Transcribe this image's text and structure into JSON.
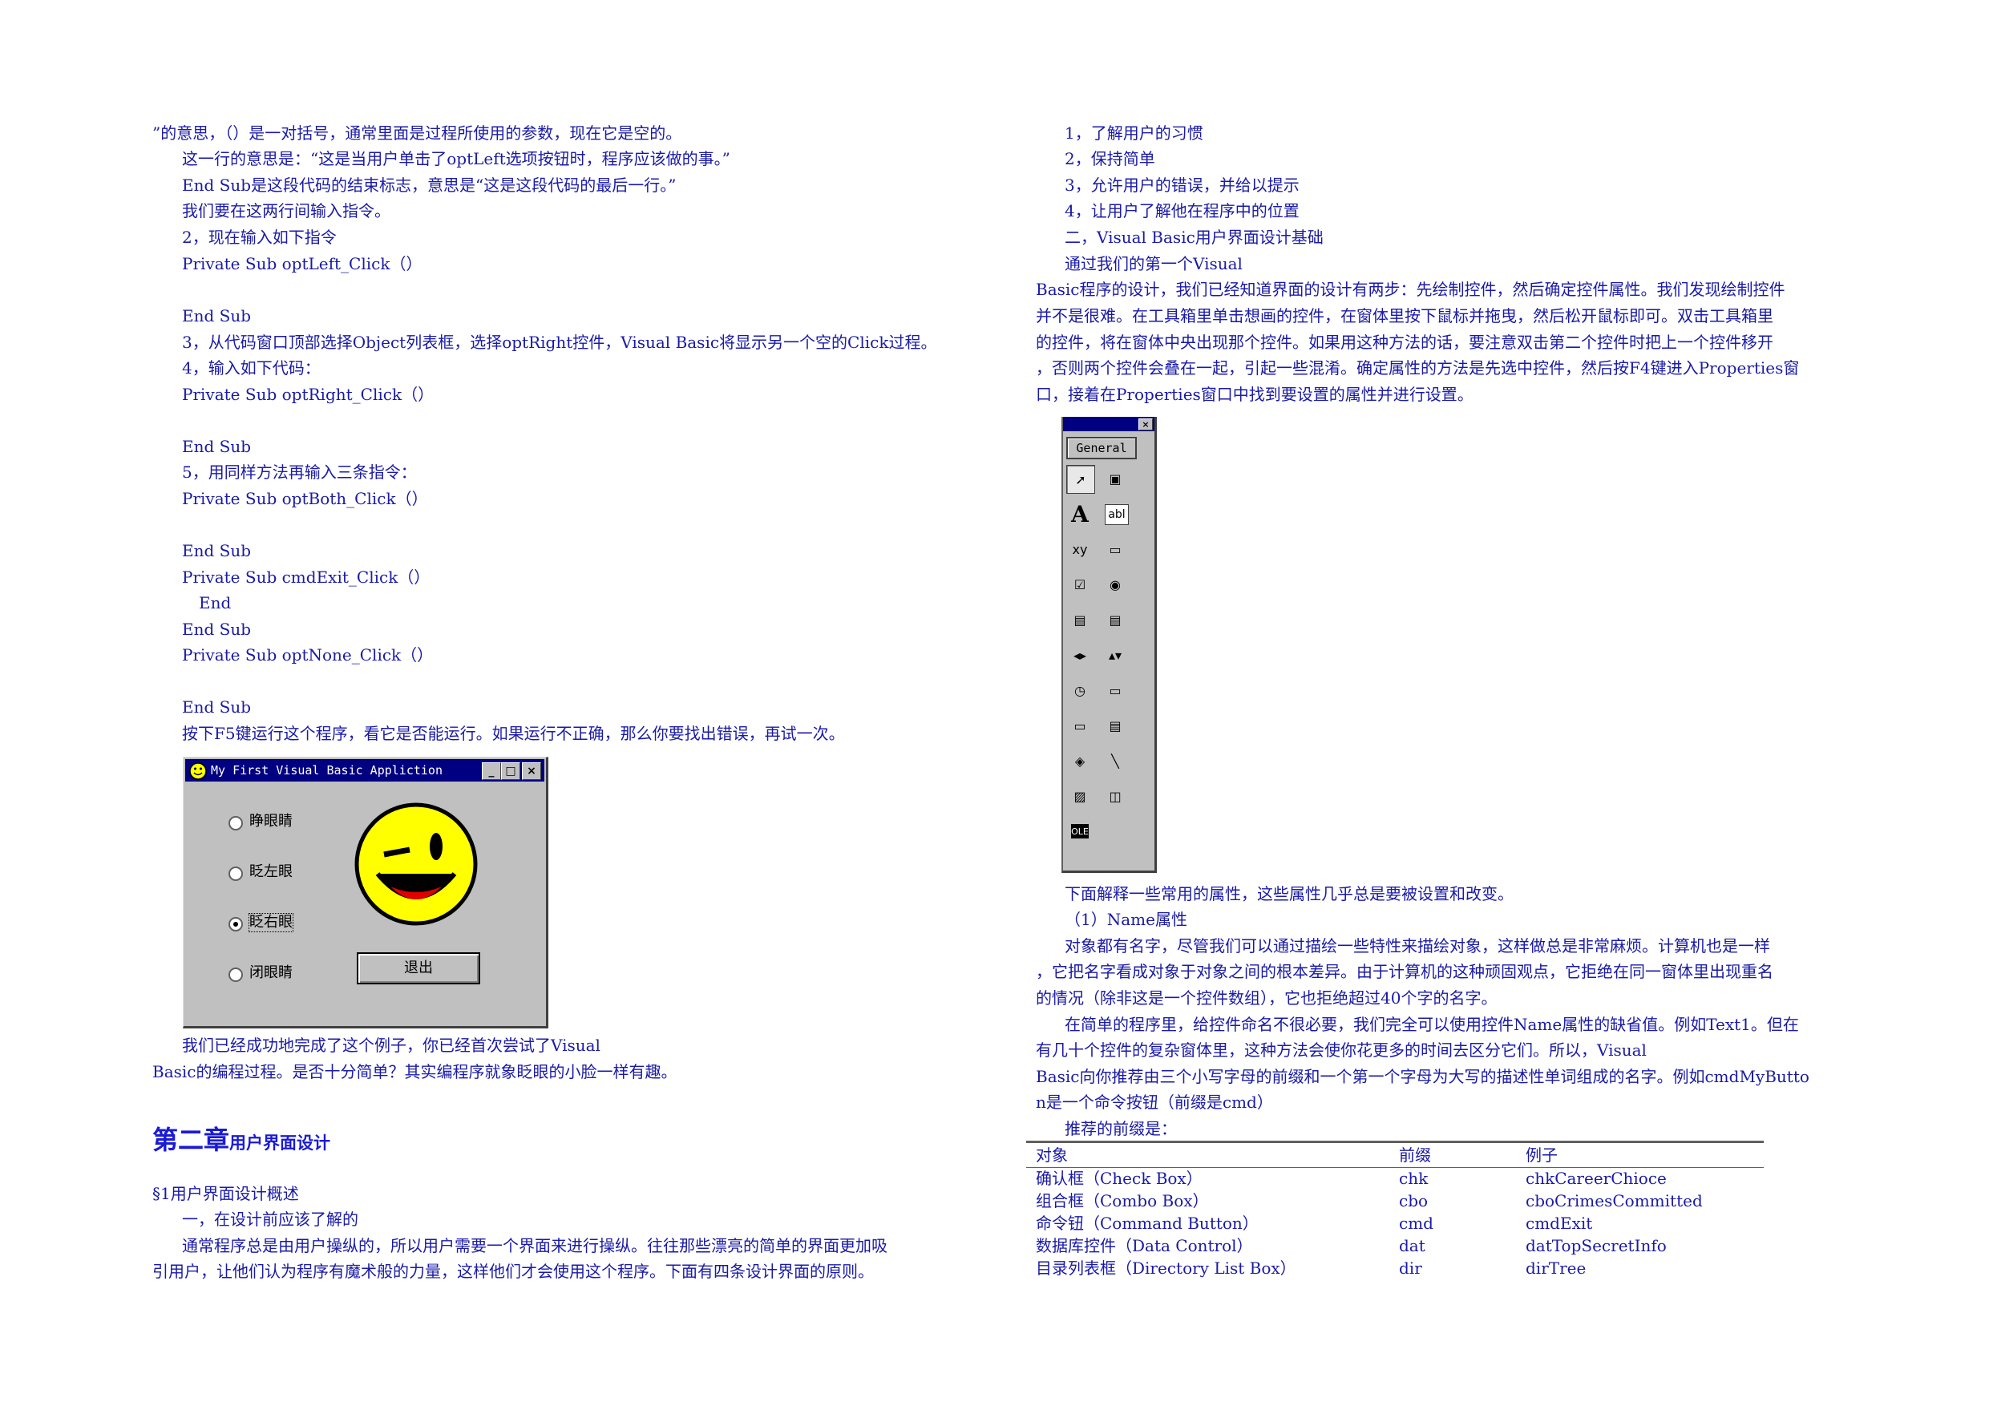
{
  "left_column": {
    "lines": [
      "”的意思，（）是一对括号，通常里面是过程所使用的参数，现在它是空的。",
      "这一行的意思是：“这是当用户单击了optLeft选项按钮时，程序应该做的事。”",
      "End Sub是这段代码的结束标志，意思是“这是这段代码的最后一行。”",
      "我们要在这两行间输入指令。",
      "2，现在输入如下指令",
      "Private Sub optLeft_Click（）",
      "End Sub",
      "3，从代码窗口顶部选择Object列表框，选择optRight控件，Visual Basic将显示另一个空的Click过程。",
      "4，输入如下代码：",
      "Private Sub optRight_Click（）",
      "End Sub",
      "5，用同样方法再输入三条指令：",
      "Private Sub optBoth_Click（）",
      "End Sub",
      "Private Sub cmdExit_Click（）",
      "End",
      "End Sub",
      "Private Sub optNone_Click（）",
      "End Sub",
      "按下F5键运行这个程序，看它是否能运行。如果运行不正确，那么你要找出错误，再试一次。"
    ],
    "after_figure": [
      "我们已经成功地完成了这个例子，你已经首次尝试了Visual",
      "Basic的编程过程。是否十分简单？其实编程序就象眨眼的小脸一样有趣。"
    ],
    "chapter_title_big": "第二章",
    "chapter_title_small": "用户界面设计",
    "section_title": "§1用户界面设计概述",
    "section_lines": [
      "一，在设计前应该了解的",
      "通常程序总是由用户操纵的，所以用户需要一个界面来进行操纵。往往那些漂亮的简单的界面更加吸",
      "引用户，让他们认为程序有魔术般的力量，这样他们才会使用这个程序。下面有四条设计界面的原则。"
    ]
  },
  "vb_window": {
    "title": "My First Visual Basic Appliction",
    "min_btn": "_",
    "max_btn": "□",
    "close_btn": "×",
    "options": [
      "睁眼睛",
      "眨左眼",
      "眨右眼",
      "闭眼睛"
    ],
    "selected_option": "眨右眼",
    "exit_label": "退出"
  },
  "right_column": {
    "lines": [
      "1，了解用户的习惯",
      "2，保持简单",
      "3，允许用户的错误，并给以提示",
      "4，让用户了解他在程序中的位置",
      "二，Visual Basic用户界面设计基础",
      "通过我们的第一个Visual",
      "Basic程序的设计，我们已经知道界面的设计有两步：先绘制控件，然后确定控件属性。我们发现绘制控件",
      "并不是很难。在工具箱里单击想画的控件，在窗体里按下鼠标并拖曳，然后松开鼠标即可。双击工具箱里",
      "的控件，将在窗体中央出现那个控件。如果用这种方法的话，要注意双击第二个控件时把上一个控件移开",
      "，否则两个控件会叠在一起，引起一些混淆。确定属性的方法是先选中控件，然后按F4键进入Properties窗",
      "口，接着在Properties窗口中找到要设置的属性并进行设置。"
    ],
    "after_toolbox": [
      "下面解释一些常用的属性，这些属性几乎总是要被设置和改变。",
      "（1）Name属性",
      "对象都有名字，尽管我们可以通过描绘一些特性来描绘对象，这样做总是非常麻烦。计算机也是一样",
      "，它把名字看成对象于对象之间的根本差异。由于计算机的这种顽固观点，它拒绝在同一窗体里出现重名",
      "的情况（除非这是一个控件数组），它也拒绝超过40个字的名字。",
      "在简单的程序里，给控件命名不很必要，我们完全可以使用控件Name属性的缺省值。例如Text1。但在",
      "有几十个控件的复杂窗体里，这种方法会使你花更多的时间去区分它们。所以，Visual",
      "Basic向你推荐由三个小写字母的前缀和一个第一个字母为大写的描述性单词组成的名字。例如cmdMyButto",
      "n是一个命令按钮（前缀是cmd）",
      "推荐的前缀是："
    ]
  },
  "toolbox": {
    "general_label": "General",
    "close_btn": "×",
    "icons": [
      "pointer-icon",
      "picturebox-icon",
      "label-icon",
      "textbox-icon",
      "frame-icon",
      "commandbutton-icon",
      "checkbox-icon",
      "optionbutton-icon",
      "combobox-icon",
      "listbox-icon",
      "hscrollbar-icon",
      "vscrollbar-icon",
      "timer-icon",
      "drivelistbox-icon",
      "dirlistbox-icon",
      "filelistbox-icon",
      "shape-icon",
      "line-icon",
      "image-icon",
      "data-icon",
      "ole-icon"
    ],
    "glyphs": [
      "➚",
      "▣",
      "A",
      "abl",
      "xy",
      "▭",
      "☑",
      "◉",
      "▤",
      "▤",
      "◂▸",
      "▴▾",
      "◷",
      "▭",
      "▭",
      "▤",
      "◈",
      "╲",
      "▨",
      "◫",
      "OLE"
    ]
  },
  "prefix_table": {
    "headers": [
      "对象",
      "前缀",
      "例子"
    ],
    "rows": [
      [
        "确认框（Check Box）",
        "chk",
        "chkCareerChioce"
      ],
      [
        "组合框（Combo Box）",
        "cbo",
        "cboCrimesCommitted"
      ],
      [
        "命令钮（Command Button）",
        "cmd",
        "cmdExit"
      ],
      [
        "数据库控件（Data Control）",
        "dat",
        "datTopSecretInfo"
      ],
      [
        "目录列表框（Directory List Box）",
        "dir",
        "dirTree"
      ]
    ]
  },
  "colors": {
    "text": "#1a1aa6",
    "heading": "#1a1ad8",
    "title_bar": "#000080",
    "face": "#ffff00"
  }
}
